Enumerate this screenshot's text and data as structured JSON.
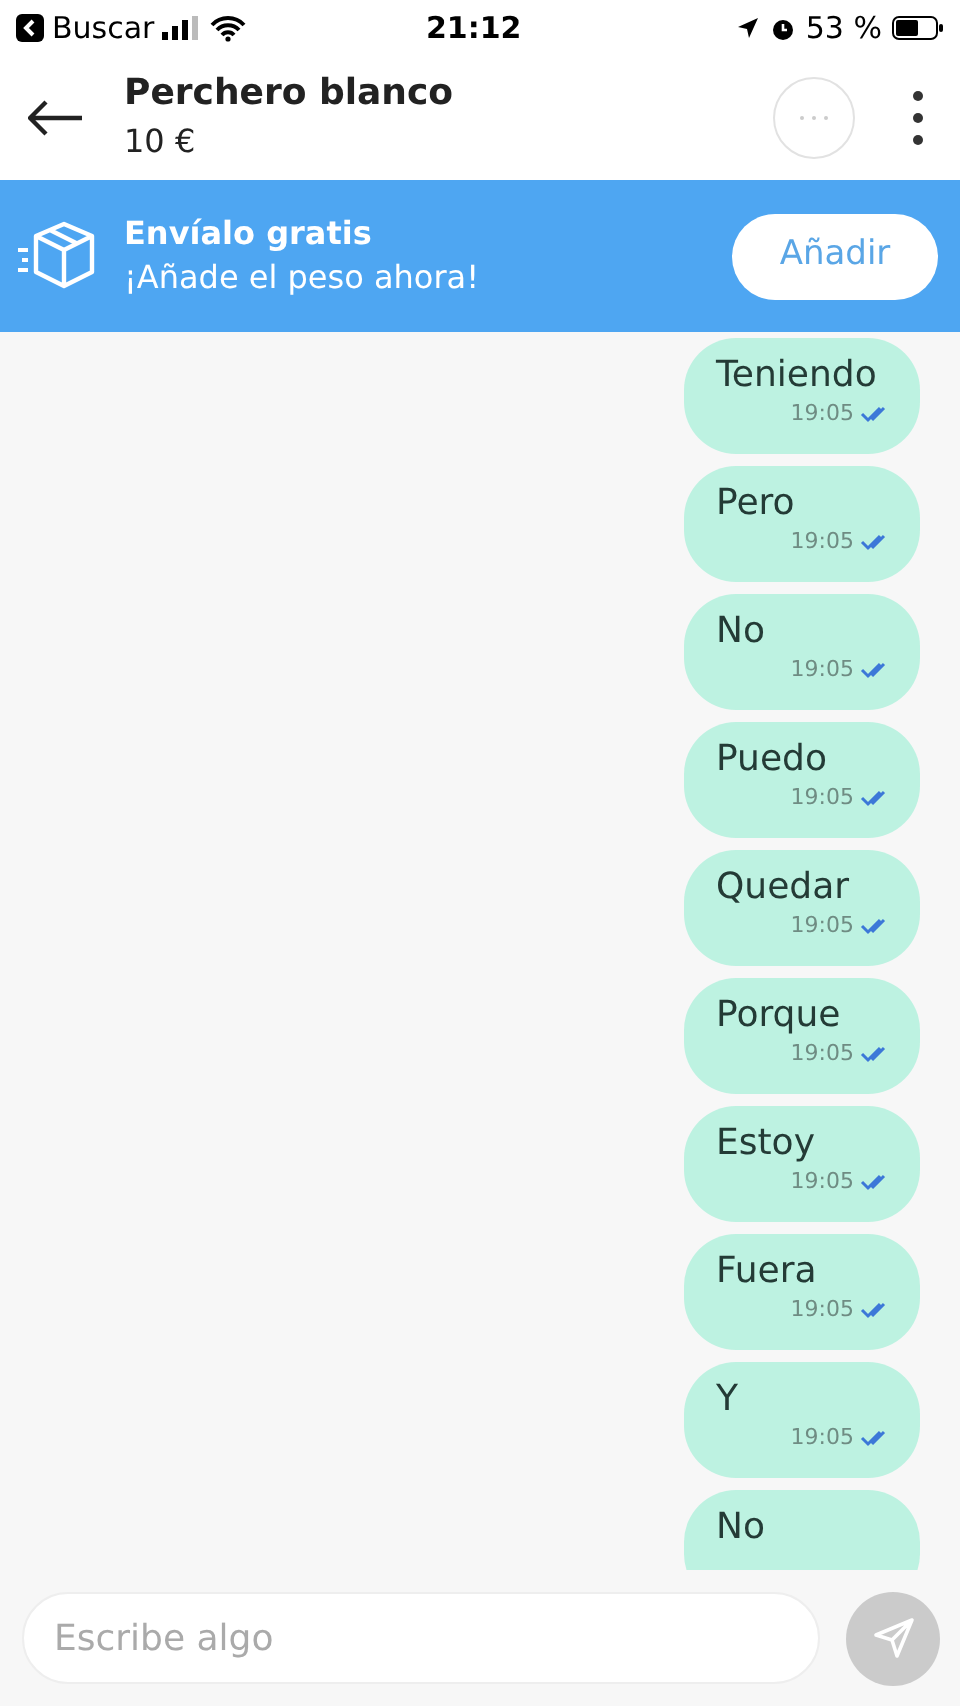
{
  "status_bar": {
    "back_label": "Buscar",
    "time": "21:12",
    "battery": "53 %"
  },
  "header": {
    "title": "Perchero blanco",
    "price": "10 €"
  },
  "banner": {
    "title": "Envíalo gratis",
    "subtitle": "¡Añade el peso ahora!",
    "button": "Añadir"
  },
  "messages": [
    {
      "text": "Teniendo",
      "time": "19:05",
      "read": true
    },
    {
      "text": "Pero",
      "time": "19:05",
      "read": true
    },
    {
      "text": "No",
      "time": "19:05",
      "read": true
    },
    {
      "text": "Puedo",
      "time": "19:05",
      "read": true
    },
    {
      "text": "Quedar",
      "time": "19:05",
      "read": true
    },
    {
      "text": "Porque",
      "time": "19:05",
      "read": true
    },
    {
      "text": "Estoy",
      "time": "19:05",
      "read": true
    },
    {
      "text": "Fuera",
      "time": "19:05",
      "read": true
    },
    {
      "text": "Y",
      "time": "19:05",
      "read": true
    },
    {
      "text": "No"
    }
  ],
  "composer": {
    "placeholder": "Escribe algo"
  }
}
